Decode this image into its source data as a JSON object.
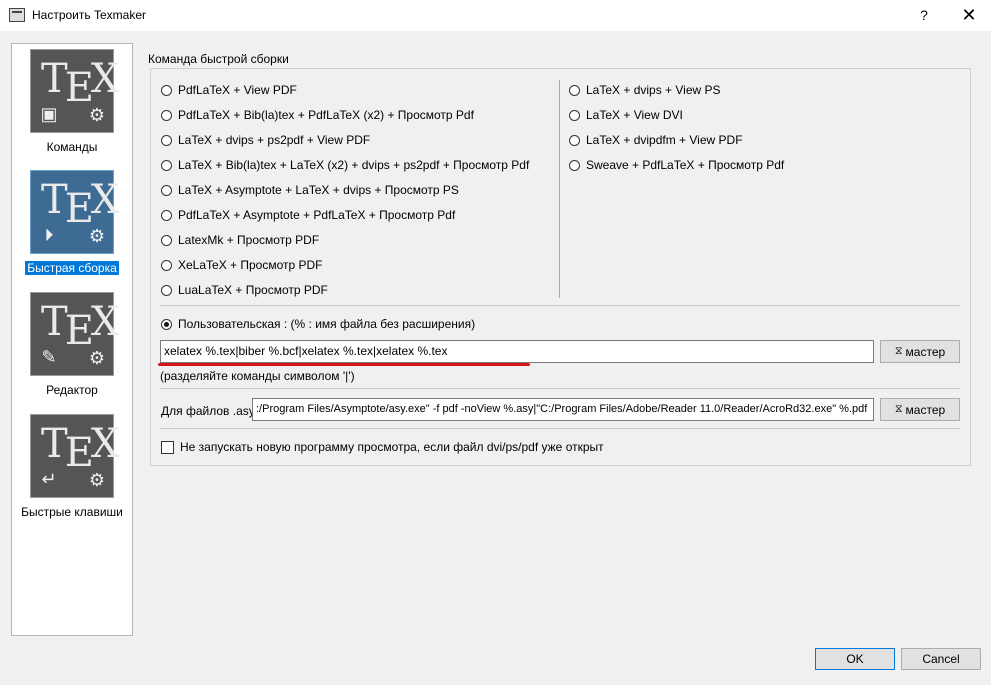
{
  "window": {
    "title": "Настроить Texmaker",
    "help": "?",
    "close": "✕"
  },
  "sidebar": {
    "items": [
      {
        "label": "Команды",
        "tex": "T",
        "tex_e": "E",
        "tex_x": "X"
      },
      {
        "label": "Быстрая сборка",
        "tex": "T",
        "tex_e": "E",
        "tex_x": "X"
      },
      {
        "label": "Редактор",
        "tex": "T",
        "tex_e": "E",
        "tex_x": "X"
      },
      {
        "label": "Быстрые клавиши",
        "tex": "T",
        "tex_e": "E",
        "tex_x": "X"
      }
    ]
  },
  "quickbuild": {
    "group_title": "Команда быстрой сборки",
    "left_options": [
      "PdfLaTeX + View PDF",
      "PdfLaTeX + Bib(la)tex + PdfLaTeX (x2) + Просмотр Pdf",
      "LaTeX + dvips + ps2pdf + View PDF",
      "LaTeX + Bib(la)tex + LaTeX (x2) + dvips + ps2pdf + Просмотр Pdf",
      "LaTeX + Asymptote + LaTeX + dvips + Просмотр PS",
      "PdfLaTeX + Asymptote + PdfLaTeX + Просмотр Pdf",
      "LatexMk + Просмотр PDF",
      "XeLaTeX + Просмотр PDF",
      "LuaLaTeX + Просмотр PDF"
    ],
    "right_options": [
      "LaTeX + dvips + View PS",
      "LaTeX + View DVI",
      "LaTeX + dvipdfm + View PDF",
      "Sweave + PdfLaTeX + Просмотр Pdf"
    ],
    "custom_label": "Пользовательская : (% : имя файла без расширения)",
    "custom_value": "xelatex %.tex|biber %.bcf|xelatex %.tex|xelatex %.tex",
    "wizard_label": "мастер",
    "hint": "(разделяйте команды символом '|')",
    "asy_label": "Для файлов .asy",
    "asy_value": ":/Program Files/Asymptote/asy.exe\" -f pdf -noView %.asy|\"C:/Program Files/Adobe/Reader 11.0/Reader/AcroRd32.exe\" %.pdf",
    "asy_wizard_label": "мастер",
    "checkbox_label": "Не запускать новую программу просмотра, если файл dvi/ps/pdf уже открыт"
  },
  "footer": {
    "ok": "OK",
    "cancel": "Cancel"
  },
  "colors": {
    "accent": "#0078d7",
    "underline": "#d7141a",
    "selected_tile": "#3d6b94"
  },
  "icons": [
    "window-icon",
    "gear-icon",
    "play-icon",
    "pencil-icon",
    "shortcut-icon",
    "wand-icon"
  ]
}
